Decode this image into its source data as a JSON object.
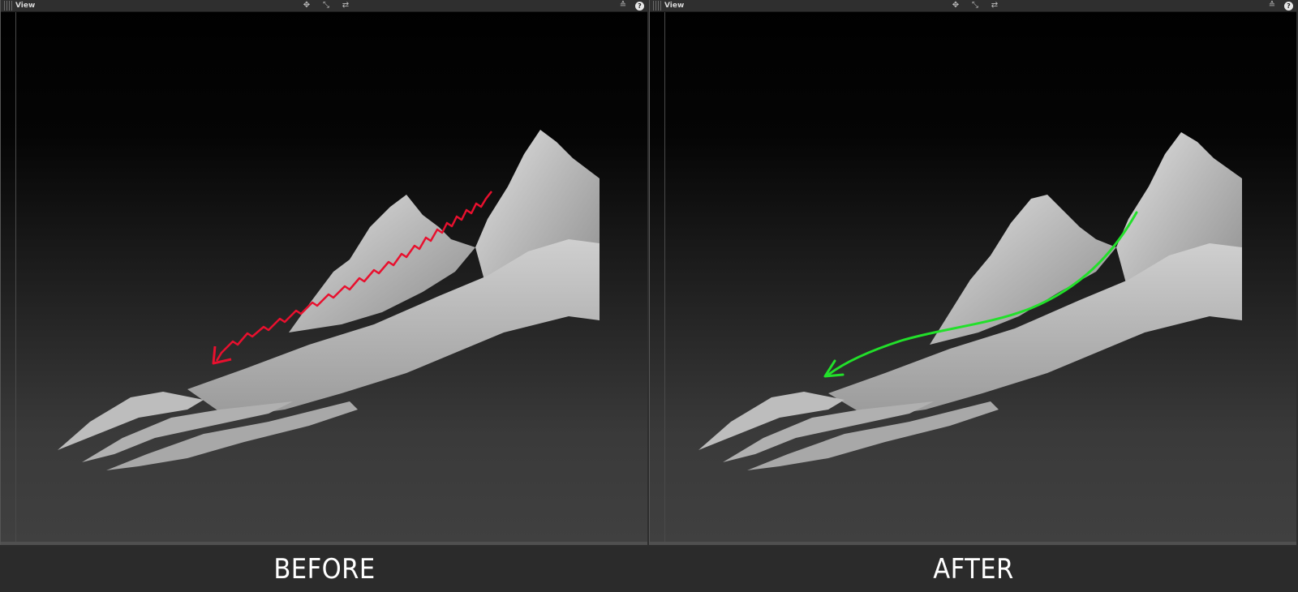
{
  "panels": [
    {
      "id": "left",
      "title": "View",
      "caption": "BEFORE",
      "arrow_color": "#e8102e",
      "arrow_style": "zigzag"
    },
    {
      "id": "right",
      "title": "View",
      "caption": "AFTER",
      "arrow_color": "#22e02a",
      "arrow_style": "smooth"
    }
  ],
  "toolbar": {
    "icons": [
      "move-icon",
      "scale-icon",
      "rotate-icon"
    ],
    "right_icons": [
      "layers-icon",
      "help-icon"
    ],
    "help_label": "?"
  },
  "colors": {
    "viewport_bg_top": "#000000",
    "viewport_bg_bottom": "#404040",
    "mesh": "#b8b8b8",
    "caption_bg": "#2b2b2b",
    "caption_text": "#ffffff"
  }
}
